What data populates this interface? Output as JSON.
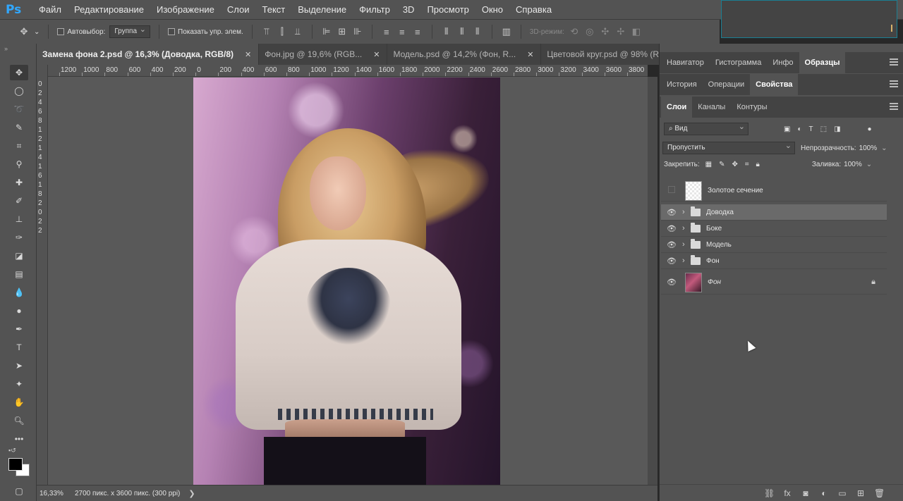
{
  "app": {
    "logo": "Ps"
  },
  "menu": [
    "Файл",
    "Редактирование",
    "Изображение",
    "Слои",
    "Текст",
    "Выделение",
    "Фильтр",
    "3D",
    "Просмотр",
    "Окно",
    "Справка"
  ],
  "options": {
    "autoselect_label": "Автовыбор:",
    "autoselect_value": "Группа",
    "show_transform_label": "Показать упр. элем.",
    "mode_3d_label": "3D-режим:"
  },
  "tabs": [
    {
      "label": "Замена фона 2.psd @ 16,3% (Доводка, RGB/8)"
    },
    {
      "label": "Фон.jpg @ 19,6% (RGB..."
    },
    {
      "label": "Модель.psd @ 14,2% (Фон, R..."
    },
    {
      "label": "Цветовой круг.psd @ 98% (R..."
    }
  ],
  "ruler_top": [
    "1200",
    "1000",
    "800",
    "600",
    "400",
    "200",
    "0",
    "200",
    "400",
    "600",
    "800",
    "1000",
    "1200",
    "1400",
    "1600",
    "1800",
    "2000",
    "2200",
    "2400",
    "2600",
    "2800",
    "3000",
    "3200",
    "3400",
    "3600",
    "3800"
  ],
  "ruler_left": [
    "0",
    "2",
    "4",
    "6",
    "8",
    "1",
    "2",
    "1",
    "4",
    "1",
    "6",
    "1",
    "8",
    "2",
    "0",
    "2",
    "2"
  ],
  "status": {
    "zoom": "16,33%",
    "doc_info": "2700 пикс. x 3600 пикс. (300 ppi)",
    "arrow": "❯"
  },
  "panels": {
    "row1_tabs": [
      "Навигатор",
      "Гистограмма",
      "Инфо",
      "Образцы"
    ],
    "row2_tabs": [
      "История",
      "Операции",
      "Свойства"
    ],
    "row3_tabs": [
      "Слои",
      "Каналы",
      "Контуры"
    ],
    "filter_kind": "Вид",
    "blend_mode": "Пропустить",
    "opacity_label": "Непрозрачность:",
    "opacity_value": "100%",
    "lock_label": "Закрепить:",
    "fill_label": "Заливка:",
    "fill_value": "100%"
  },
  "layers": [
    {
      "name": "Золотое сечение",
      "visible": false,
      "type": "layer"
    },
    {
      "name": "Доводка",
      "visible": true,
      "type": "group",
      "selected": true
    },
    {
      "name": "Боке",
      "visible": true,
      "type": "group"
    },
    {
      "name": "Модель",
      "visible": true,
      "type": "group"
    },
    {
      "name": "Фон",
      "visible": true,
      "type": "group"
    },
    {
      "name": "Фон",
      "visible": true,
      "type": "background",
      "locked": true
    }
  ],
  "colors": {
    "accent": "#31a8ff",
    "panel": "#535353",
    "canvas": "#595959"
  }
}
